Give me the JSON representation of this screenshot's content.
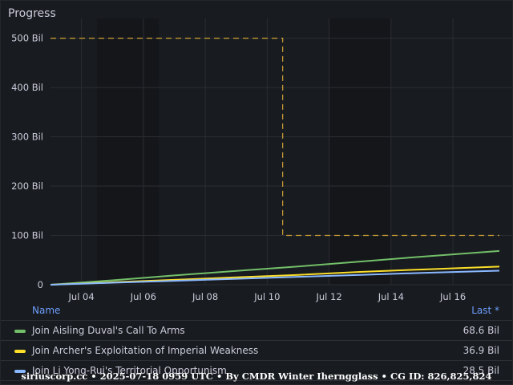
{
  "panel": {
    "title": "Progress"
  },
  "chart_data": {
    "type": "line",
    "y_ticks": [
      "0",
      "100 Bil",
      "200 Bil",
      "300 Bil",
      "400 Bil",
      "500 Bil"
    ],
    "ylim": [
      0,
      540
    ],
    "x_ticks": [
      "Jul 04",
      "Jul 06",
      "Jul 08",
      "Jul 10",
      "Jul 12",
      "Jul 14",
      "Jul 16"
    ],
    "x_tick_values": [
      "2025-07-04",
      "2025-07-06",
      "2025-07-08",
      "2025-07-10",
      "2025-07-12",
      "2025-07-14",
      "2025-07-16"
    ],
    "xlim": [
      "2025-07-03",
      "2025-07-17T12:00"
    ],
    "shaded_periods": [
      [
        "2025-07-04T12:00",
        "2025-07-06T12:00"
      ],
      [
        "2025-07-12",
        "2025-07-14"
      ]
    ],
    "grid": true,
    "target": {
      "color": "#cfa235",
      "x": [
        "2025-07-03",
        "2025-07-10T12:00",
        "2025-07-10T12:00",
        "2025-07-17T12:00"
      ],
      "y": [
        500,
        500,
        100,
        100
      ]
    },
    "series": [
      {
        "name": "Join Aisling Duval's Call To Arms",
        "color": "#73bf69",
        "x": [
          "2025-07-03",
          "2025-07-05",
          "2025-07-07",
          "2025-07-09",
          "2025-07-11",
          "2025-07-13",
          "2025-07-15",
          "2025-07-17T12:00"
        ],
        "values": [
          0,
          9,
          19,
          28,
          37,
          47,
          57,
          68.6
        ]
      },
      {
        "name": "Join Archer's Exploitation of Imperial Weakness",
        "color": "#fade2a",
        "x": [
          "2025-07-03",
          "2025-07-05",
          "2025-07-07",
          "2025-07-09",
          "2025-07-11",
          "2025-07-13",
          "2025-07-15",
          "2025-07-17T12:00"
        ],
        "values": [
          0,
          5,
          10,
          15,
          20,
          26,
          31,
          36.9
        ]
      },
      {
        "name": "Join Li Yong-Rui's Territorial Opportunism",
        "color": "#8ab8ff",
        "x": [
          "2025-07-03",
          "2025-07-05",
          "2025-07-07",
          "2025-07-09",
          "2025-07-11",
          "2025-07-13",
          "2025-07-15",
          "2025-07-17T12:00"
        ],
        "values": [
          0,
          4,
          8,
          12,
          16,
          20,
          24,
          28.5
        ]
      }
    ]
  },
  "legend": {
    "name_header": "Name",
    "last_header": "Last *",
    "rows": [
      {
        "label": "Join Aisling Duval's Call To Arms",
        "value": "68.6 Bil",
        "color": "#73bf69"
      },
      {
        "label": "Join Archer's Exploitation of Imperial Weakness",
        "value": "36.9 Bil",
        "color": "#fade2a"
      },
      {
        "label": "Join Li Yong-Rui's Territorial Opportunism",
        "value": "28.5 Bil",
        "color": "#8ab8ff"
      }
    ]
  },
  "footer": "siriuscorp.cc • 2025-07-18 0959 UTC • By CMDR Winter Iherngglass • CG ID: 826,825,824"
}
